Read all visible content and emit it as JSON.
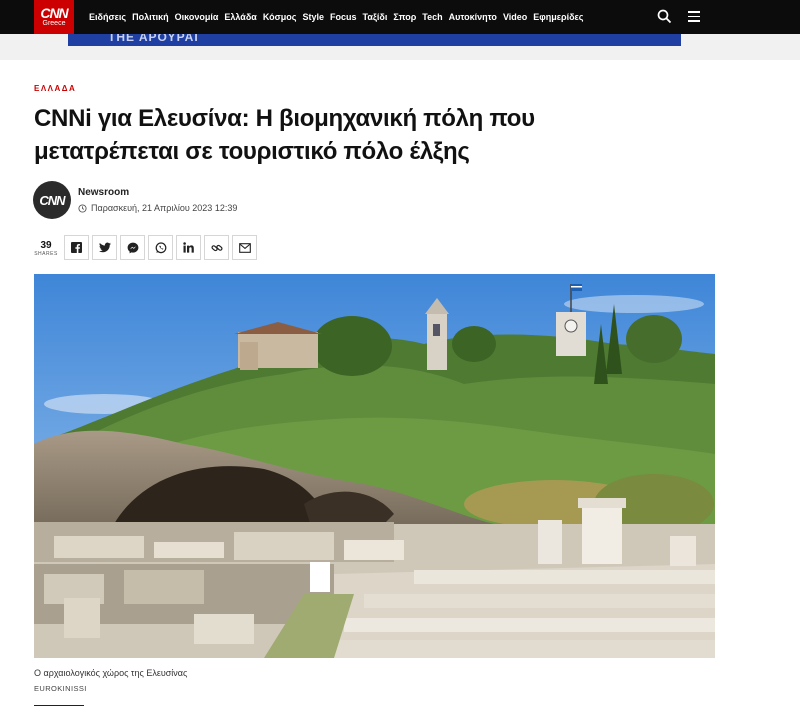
{
  "brand": {
    "logo_top": "CNN",
    "logo_bottom": "Greece"
  },
  "nav": {
    "items": [
      "Ειδήσεις",
      "Πολιτική",
      "Οικονομία",
      "Ελλάδα",
      "Κόσμος",
      "Style",
      "Focus",
      "Ταξίδι",
      "Σπορ",
      "Tech",
      "Αυτοκίνητο",
      "Video",
      "Εφημερίδες"
    ]
  },
  "ad": {
    "text": "ΤΗΕ ΑΡΟΥΡΑΙ"
  },
  "article": {
    "category": "ΕΛΛΑΔΑ",
    "headline": "CNNi για Ελευσίνα: Η βιομηχανική πόλη που μετατρέπεται σε τουριστικό πόλο έλξης",
    "author": "Newsroom",
    "avatar_text": "CNN",
    "date": "Παρασκευή, 21 Απριλίου 2023 12:39",
    "shares_count": "39",
    "shares_label": "SHARES",
    "caption": "Ο αρχαιολογικός χώρος της Ελευσίνας",
    "credit": "EUROKINISSI"
  },
  "icons": {
    "search": "search-icon",
    "menu": "hamburger-menu-icon",
    "clock": "clock-icon",
    "share": [
      "facebook-icon",
      "twitter-icon",
      "messenger-icon",
      "whatsapp-icon",
      "linkedin-icon",
      "link-icon",
      "email-icon"
    ]
  },
  "colors": {
    "accent": "#cc0000",
    "nav_bg": "#0c0c0c",
    "ad_bg": "#1f3fa3"
  }
}
